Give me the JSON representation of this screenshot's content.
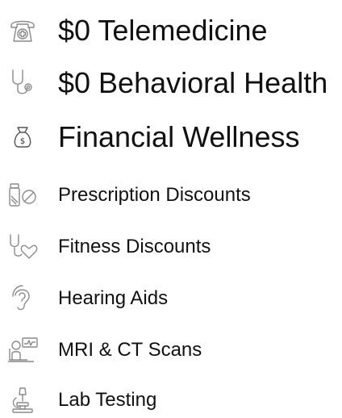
{
  "benefits": [
    {
      "label": "$0 Telemedicine",
      "icon": "telephone-medical-icon"
    },
    {
      "label": "$0 Behavioral Health",
      "icon": "stethoscope-icon"
    },
    {
      "label": "Financial Wellness",
      "icon": "money-bag-icon"
    },
    {
      "label": "Prescription Discounts",
      "icon": "pill-bottle-icon"
    },
    {
      "label": "Fitness Discounts",
      "icon": "stethoscope-heart-icon"
    },
    {
      "label": "Hearing Aids",
      "icon": "ear-icon"
    },
    {
      "label": "MRI & CT Scans",
      "icon": "mri-scan-icon"
    },
    {
      "label": "Lab Testing",
      "icon": "microscope-icon"
    }
  ],
  "colors": {
    "text": "#111111",
    "icon_stroke": "#8a8a8a",
    "background": "#ffffff"
  }
}
